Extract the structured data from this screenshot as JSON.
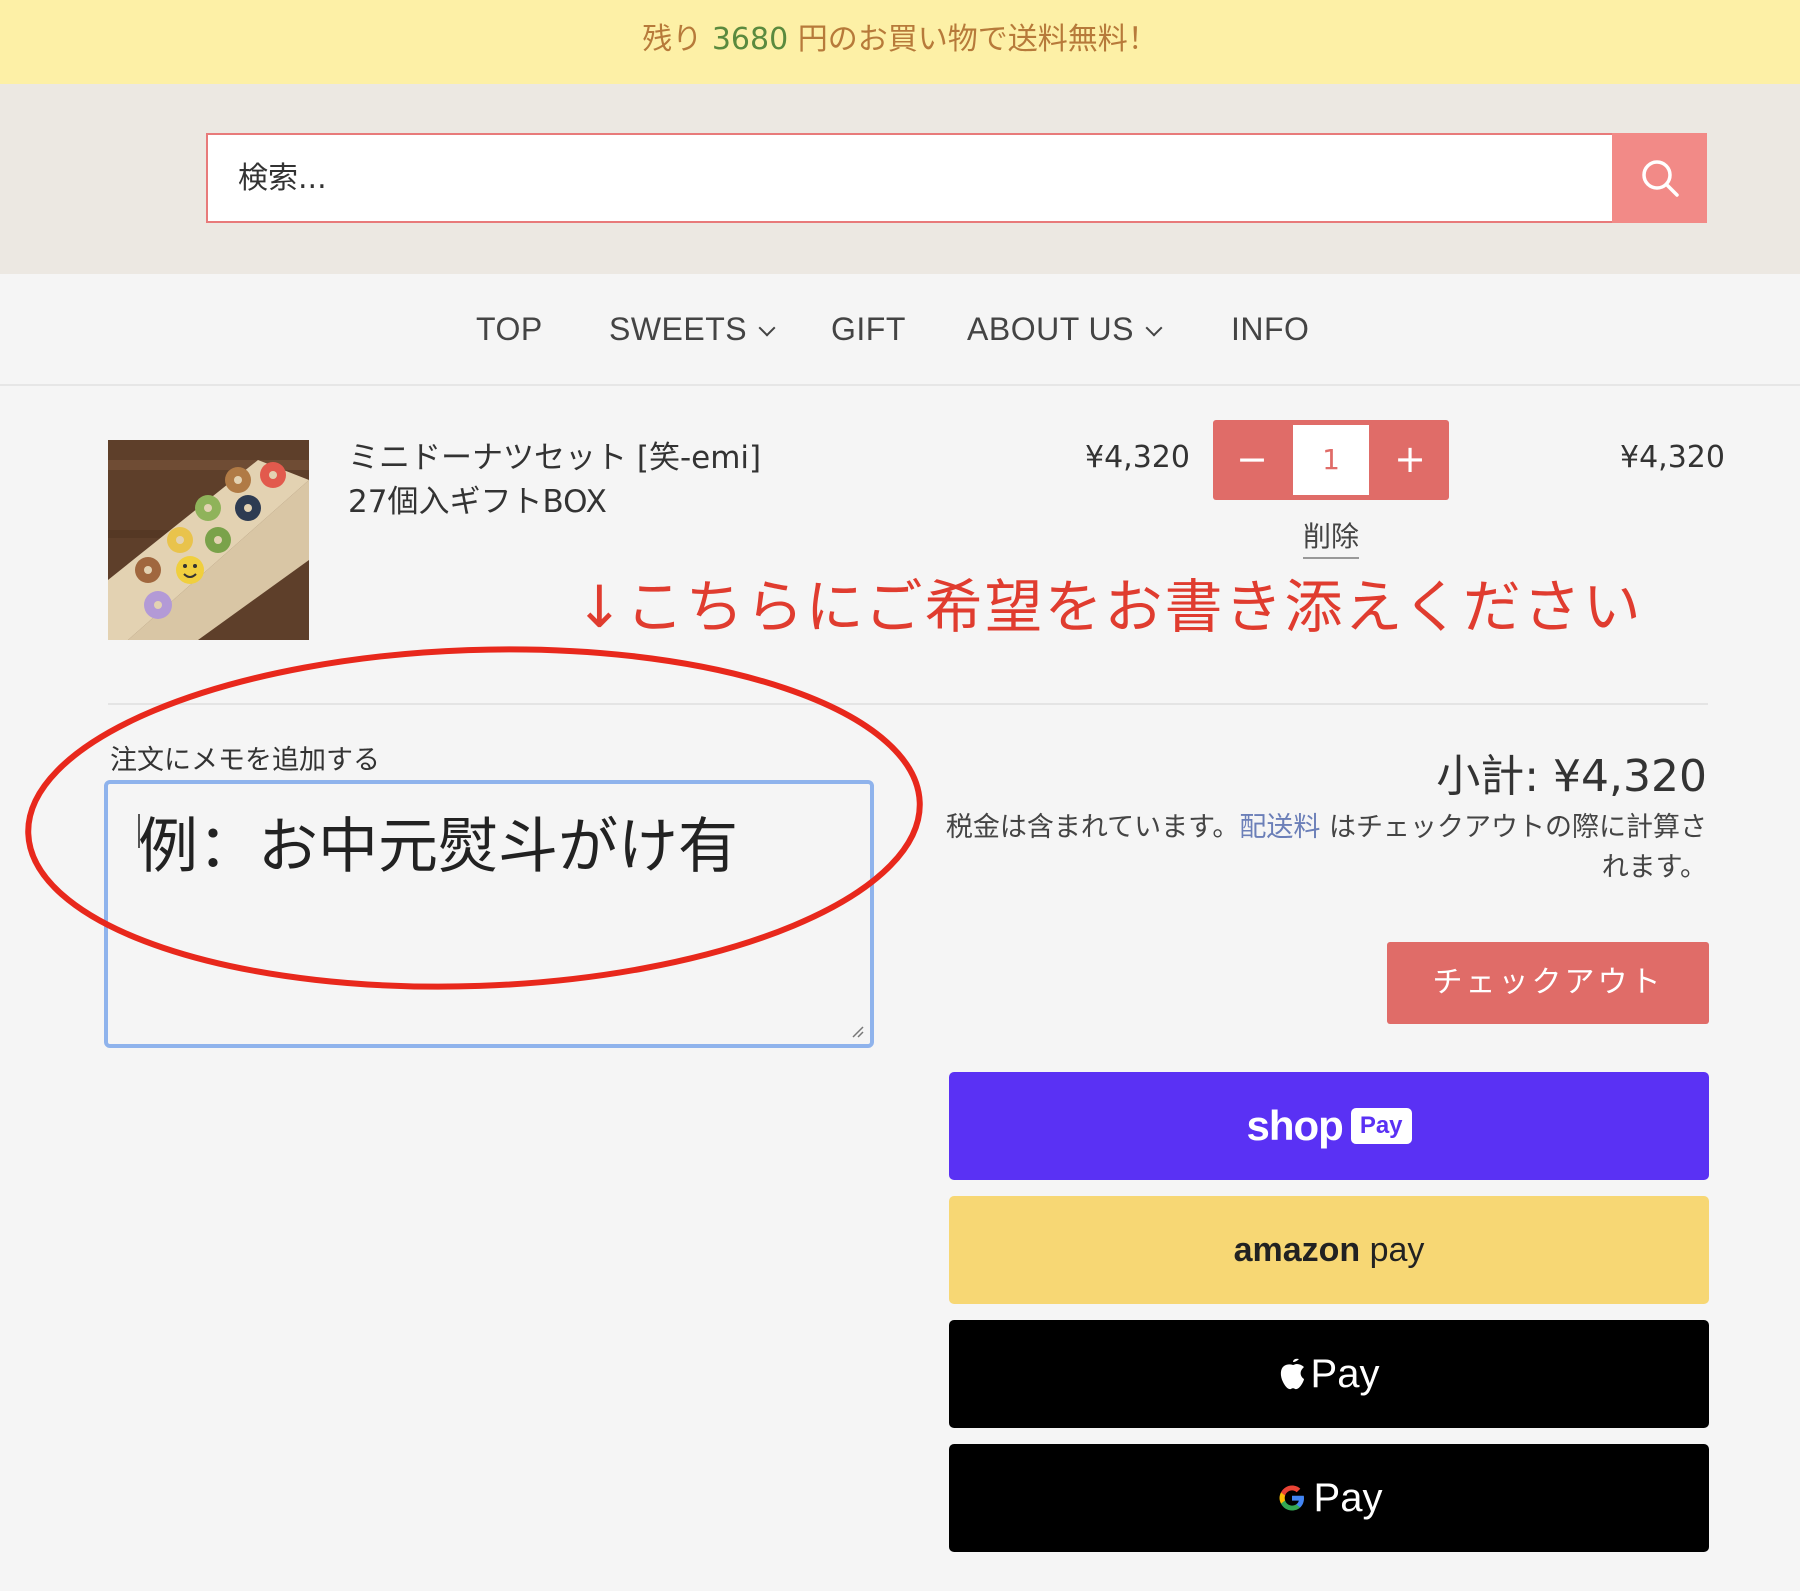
{
  "banner": {
    "prefix": "残り ",
    "amount": "3680",
    "suffix": " 円のお買い物で送料無料！"
  },
  "search": {
    "placeholder": "検索..."
  },
  "nav": {
    "items": [
      {
        "label": "TOP",
        "has_dropdown": false
      },
      {
        "label": "SWEETS",
        "has_dropdown": true
      },
      {
        "label": "GIFT",
        "has_dropdown": false
      },
      {
        "label": "ABOUT US",
        "has_dropdown": true
      },
      {
        "label": "INFO",
        "has_dropdown": false
      }
    ]
  },
  "cart_item": {
    "title_line1": "ミニドーナツセット [笑-emi]",
    "title_line2": "27個入ギフトBOX",
    "unit_price": "¥4,320",
    "quantity": "1",
    "minus": "−",
    "plus": "+",
    "remove_label": "削除",
    "line_total": "¥4,320"
  },
  "annotation": {
    "text": "↓こちらにご希望をお書き添えください",
    "color": "#e03c2f"
  },
  "note": {
    "label": "注文にメモを追加する",
    "value": "例：お中元熨斗がけ有"
  },
  "summary": {
    "subtotal": "小計: ¥4,320",
    "tax_before": "税金は含まれています。",
    "tax_link": "配送料",
    "tax_after": " はチェックアウトの際に計算されます。",
    "checkout_label": "チェックアウト"
  },
  "payments": {
    "shop_word": "shop",
    "shop_badge": "Pay",
    "amazon_word": "amazon",
    "amazon_pay": " pay",
    "apple_label": "Pay",
    "google_label": "Pay"
  },
  "colors": {
    "accent": "#e06c68",
    "shop_pay": "#5a31f4",
    "amazon_pay": "#f7d774",
    "banner_bg": "#fdf0a6"
  }
}
